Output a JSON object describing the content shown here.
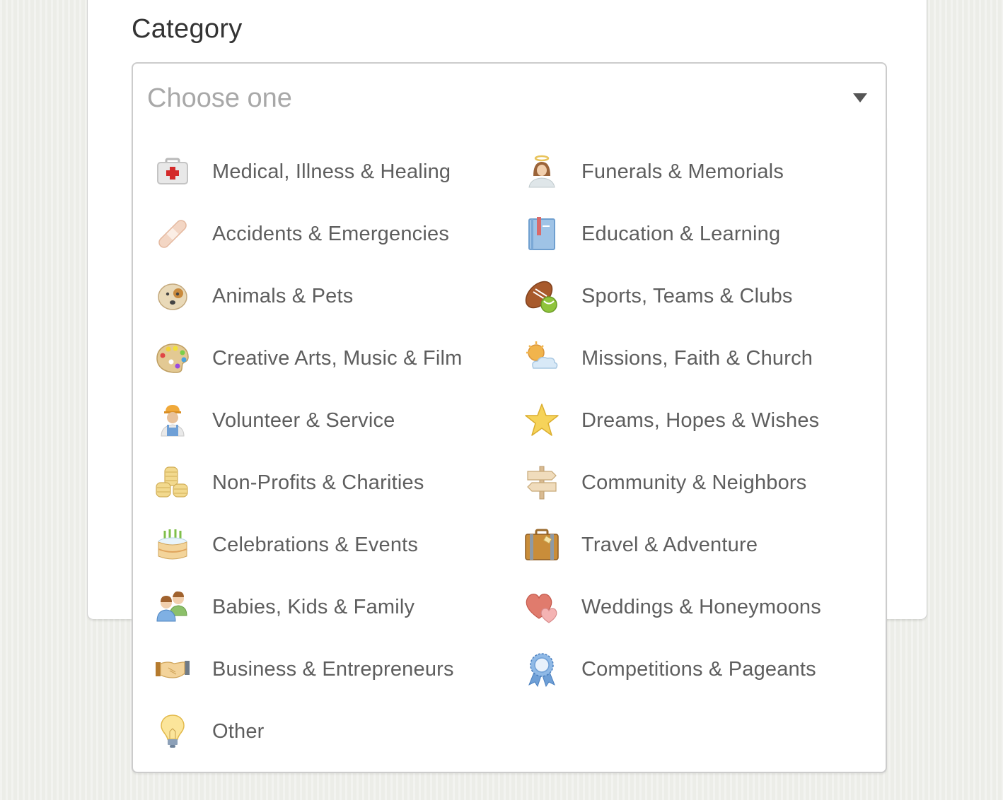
{
  "form": {
    "category_label": "Category",
    "select": {
      "placeholder": "Choose one",
      "expanded": true
    }
  },
  "options": [
    {
      "label": "Medical, Illness & Healing",
      "icon": "first-aid-kit-icon"
    },
    {
      "label": "Funerals & Memorials",
      "icon": "angel-icon"
    },
    {
      "label": "Accidents & Emergencies",
      "icon": "bandage-icon"
    },
    {
      "label": "Education & Learning",
      "icon": "book-icon"
    },
    {
      "label": "Animals & Pets",
      "icon": "dog-icon"
    },
    {
      "label": "Sports, Teams & Clubs",
      "icon": "sports-ball-icon"
    },
    {
      "label": "Creative Arts, Music & Film",
      "icon": "paint-palette-icon"
    },
    {
      "label": "Missions, Faith & Church",
      "icon": "sun-cloud-icon"
    },
    {
      "label": "Volunteer & Service",
      "icon": "worker-icon"
    },
    {
      "label": "Dreams, Hopes & Wishes",
      "icon": "star-icon"
    },
    {
      "label": "Non-Profits & Charities",
      "icon": "coins-icon"
    },
    {
      "label": "Community & Neighbors",
      "icon": "signpost-icon"
    },
    {
      "label": "Celebrations & Events",
      "icon": "birthday-cake-icon"
    },
    {
      "label": "Travel & Adventure",
      "icon": "suitcase-icon"
    },
    {
      "label": "Babies, Kids & Family",
      "icon": "family-icon"
    },
    {
      "label": "Weddings & Honeymoons",
      "icon": "hearts-icon"
    },
    {
      "label": "Business & Entrepreneurs",
      "icon": "handshake-icon"
    },
    {
      "label": "Competitions & Pageants",
      "icon": "award-ribbon-icon"
    },
    {
      "label": "Other",
      "icon": "lightbulb-icon"
    }
  ],
  "colors": {
    "text_label": "#333333",
    "option_text": "#5e5e5e",
    "placeholder": "#a8a8a8",
    "border": "#cccccc",
    "background": "#ecede8"
  }
}
